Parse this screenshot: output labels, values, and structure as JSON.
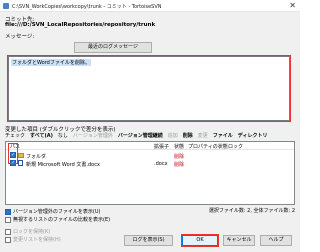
{
  "window": {
    "title": "C:\\SVN_WorkCopies\\workcopy\\trunk - コミット - TortoiseSVN",
    "close_glyph": "✕"
  },
  "commit_to": {
    "label": "コミット先:",
    "url": "file:///D:/SVN_LocalRepositories/repository/trunk"
  },
  "message": {
    "label": "メッセージ:",
    "recent_button": "最近のログメッセージ",
    "text": "フォルダとWordファイルを削除。"
  },
  "changes": {
    "label": "変更した項目 (ダブルクリックで差分を表示)",
    "filters": [
      {
        "label": "チェック",
        "bold": false,
        "enabled": true
      },
      {
        "label": "すべて(A)",
        "bold": true,
        "enabled": true
      },
      {
        "label": "なし",
        "bold": false,
        "enabled": true
      },
      {
        "label": "バージョン管理外",
        "bold": false,
        "enabled": false
      },
      {
        "label": "バージョン管理継続",
        "bold": true,
        "enabled": true
      },
      {
        "label": "追加",
        "bold": false,
        "enabled": false
      },
      {
        "label": "削除",
        "bold": true,
        "enabled": true
      },
      {
        "label": "変更",
        "bold": false,
        "enabled": false
      },
      {
        "label": "ファイル",
        "bold": true,
        "enabled": true
      },
      {
        "label": "ディレクトリ",
        "bold": true,
        "enabled": true
      }
    ],
    "columns": {
      "path": "パス",
      "ext": "拡張子",
      "status": "状態",
      "prop_status": "プロパティの状態",
      "lock": "ロック"
    },
    "rows": [
      {
        "path": "フォルダ",
        "ext": "",
        "status": "削除",
        "checked": true,
        "kind": "folder"
      },
      {
        "path": "新規 Microsoft Word 文書.docx",
        "ext": ".docx",
        "status": "削除",
        "checked": true,
        "kind": "doc"
      }
    ]
  },
  "options": {
    "show_unversioned": "バージョン管理外のファイルを表示(U)",
    "show_externals": "無視するリストのファイルの比較を表示(E)",
    "keep_locks": "ロックを保持(K)",
    "keep_changelists": "変更リストを保持(H)"
  },
  "selection_info": "選択ファイル数: 2, 全体ファイル数: 2",
  "buttons": {
    "show_log": "ログを表示(S)",
    "ok": "OK",
    "cancel": "キャンセル",
    "help": "ヘルプ"
  },
  "colors": {
    "highlight": "#e33333",
    "deleted": "#c00000",
    "selection": "#cde0f7"
  }
}
